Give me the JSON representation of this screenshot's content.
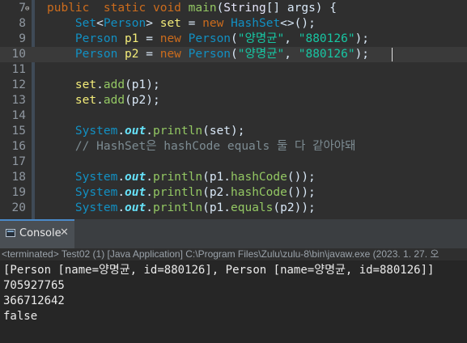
{
  "editor": {
    "lines": [
      {
        "num": "7",
        "parts": [
          [
            "kw",
            "public"
          ],
          [
            "",
            "  "
          ],
          [
            "kw",
            "static"
          ],
          [
            "",
            " "
          ],
          [
            "kw",
            "void"
          ],
          [
            "",
            " "
          ],
          [
            "fn",
            "main"
          ],
          [
            "",
            "("
          ],
          [
            "cls",
            "String"
          ],
          [
            "",
            "[] args) {"
          ]
        ]
      },
      {
        "num": "8",
        "parts": [
          [
            "",
            "    "
          ],
          [
            "ty",
            "Set"
          ],
          [
            "",
            "<"
          ],
          [
            "ty",
            "Person"
          ],
          [
            "",
            "> "
          ],
          [
            "var",
            "set"
          ],
          [
            "",
            " = "
          ],
          [
            "kw",
            "new"
          ],
          [
            "",
            " "
          ],
          [
            "ty",
            "HashSet"
          ],
          [
            "",
            "<>();"
          ]
        ]
      },
      {
        "num": "9",
        "parts": [
          [
            "",
            "    "
          ],
          [
            "ty",
            "Person"
          ],
          [
            "",
            " "
          ],
          [
            "var",
            "p1"
          ],
          [
            "",
            " = "
          ],
          [
            "kw",
            "new"
          ],
          [
            "",
            " "
          ],
          [
            "ty",
            "Person"
          ],
          [
            "",
            "("
          ],
          [
            "str",
            "\"양명균\""
          ],
          [
            "",
            ", "
          ],
          [
            "str",
            "\"880126\""
          ],
          [
            "",
            ");"
          ]
        ]
      },
      {
        "num": "10",
        "parts": [
          [
            "",
            "    "
          ],
          [
            "ty",
            "Person"
          ],
          [
            "",
            " "
          ],
          [
            "var",
            "p2"
          ],
          [
            "",
            " = "
          ],
          [
            "kw",
            "new"
          ],
          [
            "",
            " "
          ],
          [
            "ty",
            "Person"
          ],
          [
            "",
            "("
          ],
          [
            "str",
            "\"양명균\""
          ],
          [
            "",
            ", "
          ],
          [
            "str",
            "\"880126\""
          ],
          [
            "",
            ");"
          ]
        ]
      },
      {
        "num": "11",
        "parts": []
      },
      {
        "num": "12",
        "parts": [
          [
            "",
            "    "
          ],
          [
            "var",
            "set"
          ],
          [
            "",
            "."
          ],
          [
            "fn",
            "add"
          ],
          [
            "",
            "(p1);"
          ]
        ]
      },
      {
        "num": "13",
        "parts": [
          [
            "",
            "    "
          ],
          [
            "var",
            "set"
          ],
          [
            "",
            "."
          ],
          [
            "fn",
            "add"
          ],
          [
            "",
            "(p2);"
          ]
        ]
      },
      {
        "num": "14",
        "parts": []
      },
      {
        "num": "15",
        "parts": [
          [
            "",
            "    "
          ],
          [
            "ty",
            "System"
          ],
          [
            "",
            "."
          ],
          [
            "fld",
            "out"
          ],
          [
            "",
            "."
          ],
          [
            "fn",
            "println"
          ],
          [
            "",
            "(set);"
          ]
        ]
      },
      {
        "num": "16",
        "parts": [
          [
            "",
            "    "
          ],
          [
            "cm",
            "// HashSet은 hashCode equals 둘 다 같아야돼"
          ]
        ]
      },
      {
        "num": "17",
        "parts": []
      },
      {
        "num": "18",
        "parts": [
          [
            "",
            "    "
          ],
          [
            "ty",
            "System"
          ],
          [
            "",
            "."
          ],
          [
            "fld",
            "out"
          ],
          [
            "",
            "."
          ],
          [
            "fn",
            "println"
          ],
          [
            "",
            "(p1."
          ],
          [
            "fn",
            "hashCode"
          ],
          [
            "",
            "());"
          ]
        ]
      },
      {
        "num": "19",
        "parts": [
          [
            "",
            "    "
          ],
          [
            "ty",
            "System"
          ],
          [
            "",
            "."
          ],
          [
            "fld",
            "out"
          ],
          [
            "",
            "."
          ],
          [
            "fn",
            "println"
          ],
          [
            "",
            "(p2."
          ],
          [
            "fn",
            "hashCode"
          ],
          [
            "",
            "());"
          ]
        ]
      },
      {
        "num": "20",
        "parts": [
          [
            "",
            "    "
          ],
          [
            "ty",
            "System"
          ],
          [
            "",
            "."
          ],
          [
            "fld",
            "out"
          ],
          [
            "",
            "."
          ],
          [
            "fn",
            "println"
          ],
          [
            "",
            "(p1."
          ],
          [
            "fn",
            "equals"
          ],
          [
            "",
            "(p2));"
          ]
        ]
      }
    ]
  },
  "console": {
    "tab_label": "Console",
    "close_glyph": "✕",
    "status": "<terminated> Test02 (1) [Java Application] C:\\Program Files\\Zulu\\zulu-8\\bin\\javaw.exe (2023. 1. 27. 오",
    "output": [
      "[Person [name=양명균, id=880126], Person [name=양명균, id=880126]]",
      "705927765",
      "366712642",
      "false"
    ]
  },
  "colors": {
    "editor_bg": "#2f2f2f",
    "keyword": "#cc6c1d",
    "type": "#1290c3",
    "string": "#17c6a3",
    "comment": "#7d8c93",
    "console_bg": "#262626"
  }
}
